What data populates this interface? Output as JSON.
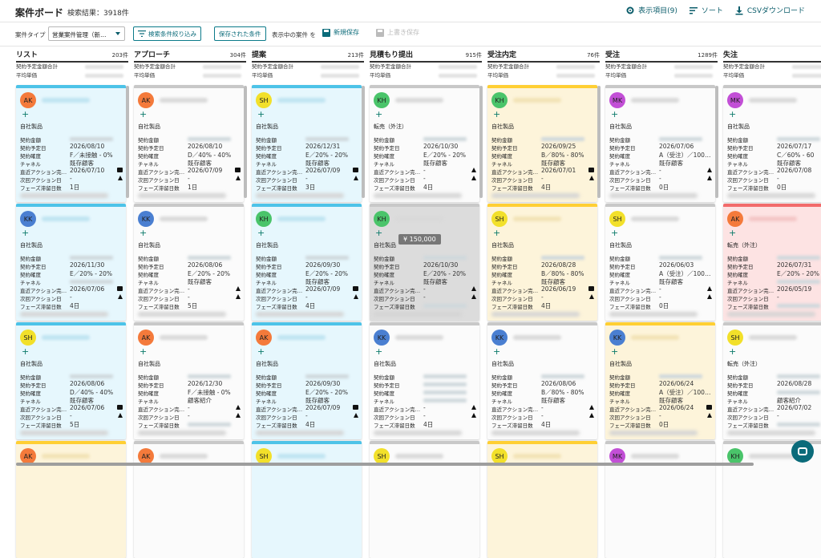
{
  "app": {
    "title": "案件ボード",
    "result_count": "検索結果：3918件"
  },
  "top_actions": {
    "columns": "表示項目(9)",
    "sort": "ソート",
    "csv": "CSVダウンロード"
  },
  "filter": {
    "type_label": "案件タイプ",
    "type_value": "営業案件管理（新…",
    "search_filter": "検索条件絞り込み",
    "saved_conditions": "保存された条件",
    "current_label": "表示中の案件 を",
    "new_save": "新規保存",
    "overwrite_save": "上書き保存"
  },
  "summary_labels": {
    "contract_total": "契約予定金額合計",
    "avg_price": "平均単価"
  },
  "field_labels": {
    "amount": "契約金額",
    "date": "契約予定日",
    "certainty": "契約確度",
    "channel": "チャネル",
    "recent_action": "直近アクション完…",
    "next_action": "次回アクション日",
    "phase_days": "フェーズ滞留日数"
  },
  "tooltip": "¥ 150,000",
  "columns": [
    {
      "name": "リスト",
      "count": "203件",
      "cards": [
        {
          "style": "bl",
          "initials": "AK",
          "avatar": "#f47a3b",
          "category": "自社製品",
          "date": "2026/08/10",
          "certainty": "F／未接触 - 0%",
          "channel": "既存顧客",
          "recent": "2026/07/10",
          "next": "-",
          "days": "1日",
          "icon": "bag"
        },
        {
          "style": "bl",
          "initials": "KK",
          "avatar": "#4a7fd1",
          "category": "自社製品",
          "date": "2026/11/30",
          "certainty": "E／20% - 20%",
          "channel": "",
          "recent": "2026/07/06",
          "next": "-",
          "days": "4日",
          "icon": "bag"
        },
        {
          "style": "bl",
          "initials": "SH",
          "avatar": "#f2e02a",
          "category": "自社製品",
          "date": "2026/08/06",
          "certainty": "D／40% - 40%",
          "channel": "既存顧客",
          "recent": "2026/07/06",
          "next": "-",
          "days": "5日",
          "icon": "bag"
        },
        {
          "style": "ye",
          "initials": "AK",
          "avatar": "#f47a3b"
        }
      ]
    },
    {
      "name": "アプローチ",
      "count": "304件",
      "cards": [
        {
          "style": "wh",
          "initials": "AK",
          "avatar": "#f47a3b",
          "category": "自社製品",
          "date": "2026/08/10",
          "certainty": "D／40% - 40%",
          "channel": "既存顧客",
          "recent": "2026/07/09",
          "next": "-",
          "days": "1日",
          "icon": "bag"
        },
        {
          "style": "wh",
          "initials": "KK",
          "avatar": "#4a7fd1",
          "category": "自社製品",
          "date": "2026/08/06",
          "certainty": "E／20% - 20%",
          "channel": "既存顧客",
          "recent": "-",
          "next": "-",
          "days": "5日",
          "icon": "tri"
        },
        {
          "style": "wh",
          "initials": "AK",
          "avatar": "#f47a3b",
          "category": "自社製品",
          "date": "2026/12/30",
          "certainty": "F／未接触 - 0%",
          "channel": "顧客紹介",
          "recent": "-",
          "next": "-",
          "days": "",
          "icon": "tri"
        },
        {
          "style": "wh",
          "initials": "AK",
          "avatar": "#f47a3b"
        }
      ]
    },
    {
      "name": "提案",
      "count": "213件",
      "cards": [
        {
          "style": "bl",
          "initials": "SH",
          "avatar": "#f2e02a",
          "category": "自社製品",
          "date": "2026/12/31",
          "certainty": "E／20% - 20%",
          "channel": "既存顧客",
          "recent": "2026/07/09",
          "next": "-",
          "days": "3日",
          "icon": "bag"
        },
        {
          "style": "bl",
          "initials": "KH",
          "avatar": "#4ac46a",
          "category": "自社製品",
          "date": "2026/09/30",
          "certainty": "E／20% - 20%",
          "channel": "既存顧客",
          "recent": "2026/07/09",
          "next": "-",
          "days": "4日",
          "icon": "bag"
        },
        {
          "style": "bl",
          "initials": "AK",
          "avatar": "#f47a3b",
          "category": "自社製品",
          "date": "2026/09/30",
          "certainty": "E／20% - 20%",
          "channel": "既存顧客",
          "recent": "2026/07/09",
          "next": "-",
          "days": "4日",
          "icon": "bag"
        },
        {
          "style": "bl",
          "initials": "SH",
          "avatar": "#f2e02a"
        }
      ]
    },
    {
      "name": "見積もり提出",
      "count": "915件",
      "cards": [
        {
          "style": "wh",
          "initials": "KH",
          "avatar": "#4ac46a",
          "category": "転売（外注）",
          "date": "2026/10/30",
          "certainty": "E／20% - 20%",
          "channel": "既存顧客",
          "recent": "-",
          "next": "-",
          "days": "4日",
          "icon": "tri"
        },
        {
          "style": "gy",
          "initials": "KH",
          "avatar": "#4ac46a",
          "category": "自社製品",
          "date": "2026/10/30",
          "certainty": "E／20% - 20%",
          "channel": "既存顧客",
          "recent": "-",
          "next": "-",
          "days": "",
          "icon": "tri"
        },
        {
          "style": "wh",
          "initials": "KK",
          "avatar": "#4a7fd1",
          "category": "自社製品",
          "date": "",
          "certainty": "",
          "channel": "",
          "recent": "-",
          "next": "-",
          "days": "4日",
          "icon": "tri"
        },
        {
          "style": "wh",
          "initials": "SH",
          "avatar": "#f2e02a"
        }
      ]
    },
    {
      "name": "受注内定",
      "count": "76件",
      "cards": [
        {
          "style": "ye",
          "initials": "KH",
          "avatar": "#4ac46a",
          "category": "自社製品",
          "date": "2026/09/25",
          "certainty": "B／80% - 80%",
          "channel": "既存顧客",
          "recent": "2026/07/01",
          "next": "-",
          "days": "4日",
          "icon": "bag"
        },
        {
          "style": "ye",
          "initials": "SH",
          "avatar": "#f2e02a",
          "category": "自社製品",
          "date": "2026/08/28",
          "certainty": "B／80% - 80%",
          "channel": "既存顧客",
          "recent": "2026/06/19",
          "next": "-",
          "days": "4日",
          "icon": "bag"
        },
        {
          "style": "wh",
          "initials": "KK",
          "avatar": "#4a7fd1",
          "category": "自社製品",
          "date": "2026/08/06",
          "certainty": "B／80% - 80%",
          "channel": "既存顧客",
          "recent": "-",
          "next": "-",
          "days": "4日",
          "icon": "tri"
        },
        {
          "style": "ye",
          "initials": "SH",
          "avatar": "#f2e02a"
        }
      ]
    },
    {
      "name": "受注",
      "count": "1289件",
      "cards": [
        {
          "style": "wh",
          "initials": "MK",
          "avatar": "#c24fd6",
          "category": "自社製品",
          "date": "2026/07/06",
          "certainty": "A（受注）／100…",
          "channel": "既存顧客",
          "recent": "-",
          "next": "-",
          "days": "0日",
          "icon": "tri"
        },
        {
          "style": "wh",
          "initials": "SH",
          "avatar": "#f2e02a",
          "category": "自社製品",
          "date": "2026/06/03",
          "certainty": "A（受注）／100…",
          "channel": "既存顧客",
          "recent": "-",
          "next": "-",
          "days": "0日",
          "icon": "tri"
        },
        {
          "style": "ye",
          "initials": "KK",
          "avatar": "#4a7fd1",
          "category": "自社製品",
          "date": "2026/06/24",
          "certainty": "A（受注）／100…",
          "channel": "既存顧客",
          "recent": "2026/06/24",
          "next": "-",
          "days": "0日",
          "icon": "mail"
        },
        {
          "style": "wh",
          "initials": "MK",
          "avatar": "#c24fd6"
        }
      ]
    },
    {
      "name": "失注",
      "count": "",
      "cards": [
        {
          "style": "wh",
          "initials": "MK",
          "avatar": "#c24fd6",
          "category": "自社製品",
          "date": "2026/07/17",
          "certainty": "C／60% - 60",
          "channel": "既存顧客",
          "recent": "2026/07/08",
          "next": "-",
          "days": "0日",
          "icon": ""
        },
        {
          "style": "pk",
          "initials": "AK",
          "avatar": "#f47a3b",
          "category": "転売（外注）",
          "date": "2026/07/31",
          "certainty": "E／20% - 20%",
          "channel": "",
          "recent": "2026/05/19",
          "next": "-",
          "days": "",
          "icon": ""
        },
        {
          "style": "wh",
          "initials": "SH",
          "avatar": "#f2e02a",
          "category": "転売（外注）",
          "date": "2026/08/28",
          "certainty": "",
          "channel": "顧客紹介",
          "recent": "2026/07/02",
          "next": "-",
          "days": "",
          "icon": ""
        },
        {
          "style": "wh",
          "initials": "KH",
          "avatar": "#4ac46a"
        }
      ]
    }
  ]
}
